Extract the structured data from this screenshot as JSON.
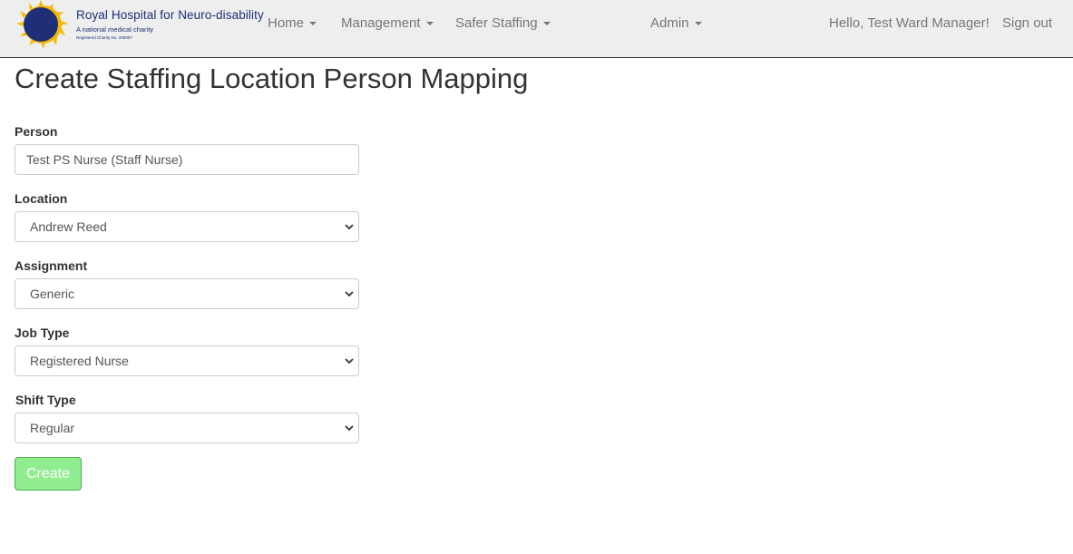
{
  "brand": {
    "name": "Royal Hospital for Neuro-disability",
    "tagline": "A national medical charity",
    "charity_no": "Registered Charity No. 205907",
    "logo_colors": {
      "circle": "#1e2f78",
      "rays": "#f5b800"
    }
  },
  "nav": {
    "home": "Home",
    "management": "Management",
    "safer_staffing": "Safer Staffing",
    "admin": "Admin",
    "greeting": "Hello, Test Ward Manager!",
    "sign_out": "Sign out"
  },
  "page": {
    "title": "Create Staffing Location Person Mapping"
  },
  "form": {
    "person": {
      "label": "Person",
      "value": "Test PS Nurse (Staff Nurse)"
    },
    "location": {
      "label": "Location",
      "value": "Andrew Reed"
    },
    "assignment": {
      "label": "Assignment",
      "value": "Generic"
    },
    "job_type": {
      "label": "Job Type",
      "value": "Registered Nurse"
    },
    "shift_type": {
      "label": "Shift Type",
      "value": "Regular"
    },
    "submit_label": "Create"
  },
  "colors": {
    "navbar_bg": "#eeeeee",
    "nav_text": "#777777",
    "button_bg": "#90ee90",
    "button_border": "#4cae4c"
  }
}
